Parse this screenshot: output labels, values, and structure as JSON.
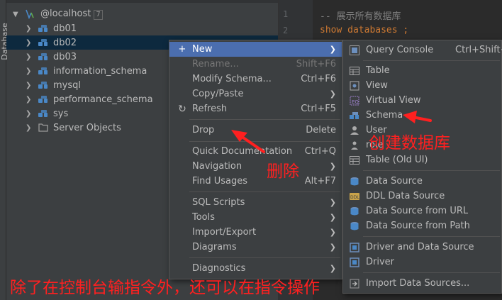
{
  "sidebar": {
    "tab_label": "Database"
  },
  "tree": {
    "root": {
      "label": "@localhost",
      "count": "7"
    },
    "items": [
      {
        "label": "db01"
      },
      {
        "label": "db02"
      },
      {
        "label": "db03"
      },
      {
        "label": "information_schema"
      },
      {
        "label": "mysql"
      },
      {
        "label": "performance_schema"
      },
      {
        "label": "sys"
      },
      {
        "label": "Server Objects"
      }
    ]
  },
  "editor": {
    "lines": [
      {
        "num": "1",
        "text": "-- 展示所有数据库"
      },
      {
        "num": "2",
        "text": "show databases ;"
      }
    ]
  },
  "context_menu": {
    "items": [
      {
        "label": "New",
        "shortcut": ""
      },
      {
        "label": "Rename...",
        "shortcut": "Shift+F6"
      },
      {
        "label": "Modify Schema...",
        "shortcut": "Ctrl+F6"
      },
      {
        "label": "Copy/Paste",
        "shortcut": ""
      },
      {
        "label": "Refresh",
        "shortcut": "Ctrl+F5"
      },
      {
        "label": "Drop",
        "shortcut": "Delete"
      },
      {
        "label": "Quick Documentation",
        "shortcut": "Ctrl+Q"
      },
      {
        "label": "Navigation",
        "shortcut": ""
      },
      {
        "label": "Find Usages",
        "shortcut": "Alt+F7"
      },
      {
        "label": "SQL Scripts",
        "shortcut": ""
      },
      {
        "label": "Tools",
        "shortcut": ""
      },
      {
        "label": "Import/Export",
        "shortcut": ""
      },
      {
        "label": "Diagrams",
        "shortcut": ""
      },
      {
        "label": "Diagnostics",
        "shortcut": ""
      }
    ]
  },
  "new_submenu": {
    "items": [
      {
        "label": "Query Console",
        "shortcut": "Ctrl+Shift+Q"
      },
      {
        "label": "Table"
      },
      {
        "label": "View"
      },
      {
        "label": "Virtual View"
      },
      {
        "label": "Schema"
      },
      {
        "label": "User"
      },
      {
        "label": "role"
      },
      {
        "label": "Table (Old UI)"
      },
      {
        "label": "Data Source"
      },
      {
        "label": "DDL Data Source"
      },
      {
        "label": "Data Source from URL"
      },
      {
        "label": "Data Source from Path"
      },
      {
        "label": "Driver and Data Source"
      },
      {
        "label": "Driver"
      },
      {
        "label": "Import Data Sources..."
      }
    ]
  },
  "annotations": {
    "create_db": "创建数据库",
    "delete": "删除",
    "bottom_note": "除了在控制台输指令外，还可以在指令操作"
  },
  "colors": {
    "annotation": "#ff2020",
    "menu_highlight": "#4b6eaf",
    "selected_row": "#0d293e",
    "db_icon": "#4a88c7"
  }
}
